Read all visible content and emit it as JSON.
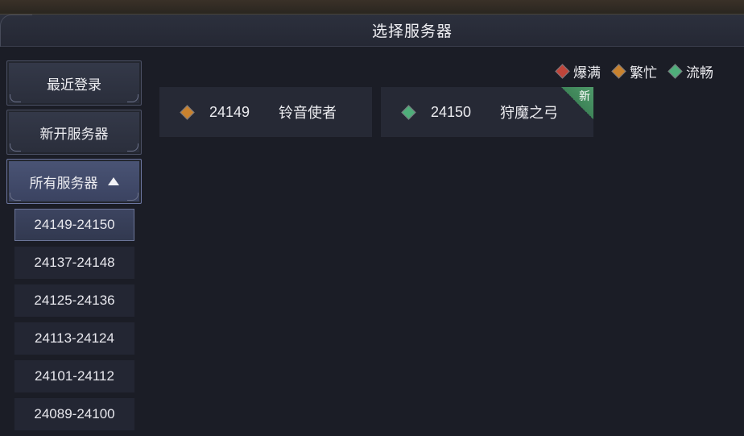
{
  "header": {
    "title": "选择服务器"
  },
  "sidebar": {
    "recent_label": "最近登录",
    "new_label": "新开服务器",
    "all_label": "所有服务器"
  },
  "ranges": [
    "24149-24150",
    "24137-24148",
    "24125-24136",
    "24113-24124",
    "24101-24112",
    "24089-24100"
  ],
  "legend": [
    {
      "label": "爆满",
      "color": "#c0453a"
    },
    {
      "label": "繁忙",
      "color": "#c9822e"
    },
    {
      "label": "流畅",
      "color": "#4fae7a"
    }
  ],
  "servers": [
    {
      "id": "24149",
      "name": "铃音使者",
      "status_color": "#c9822e",
      "badge": ""
    },
    {
      "id": "24150",
      "name": "狩魔之弓",
      "status_color": "#4fae7a",
      "badge": "新"
    }
  ],
  "colors": {
    "accent": "#6b7598",
    "new_badge": "#4f9a6a"
  }
}
